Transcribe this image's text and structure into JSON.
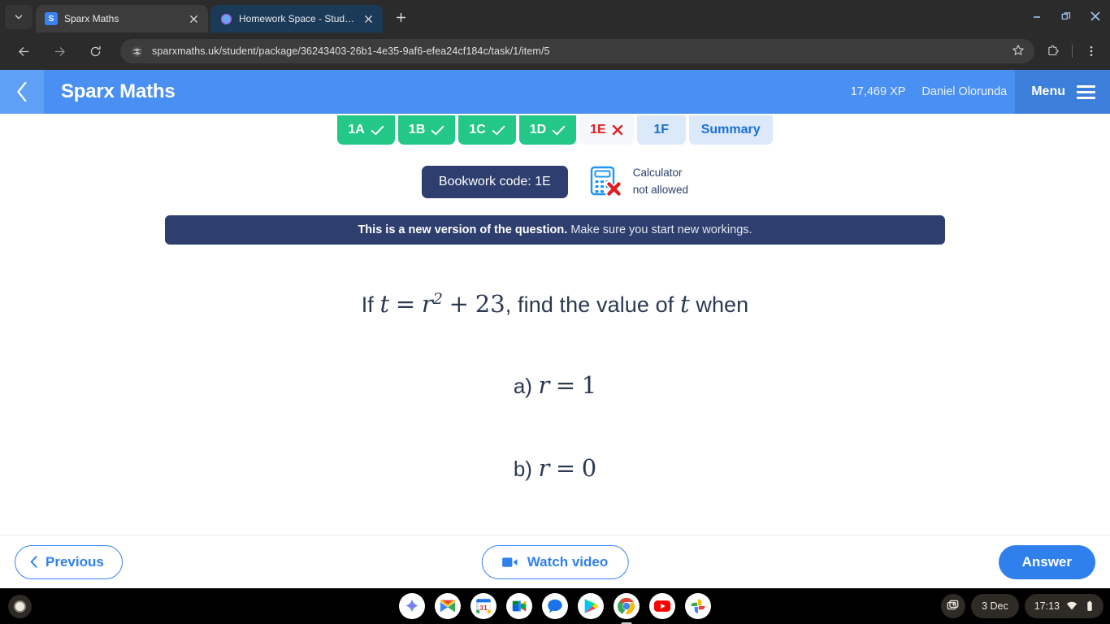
{
  "browser": {
    "tabs": [
      {
        "title": "Sparx Maths",
        "favicon": "sparx-icon",
        "active": true
      },
      {
        "title": "Homework Space - StudyX",
        "favicon": "studyx-icon",
        "active": false
      }
    ],
    "new_tab_label": "+",
    "url": "sparxmaths.uk/student/package/36243403-26b1-4e35-9af6-efea24cf184c/task/1/item/5",
    "window_controls": [
      "minimize",
      "restore",
      "close"
    ],
    "toolbar_icons": [
      "back-icon",
      "forward-icon",
      "reload-icon",
      "site-settings-icon",
      "bookmark-star-icon",
      "extensions-icon",
      "chrome-menu-icon"
    ]
  },
  "app_header": {
    "title": "Sparx Maths",
    "xp": "17,469 XP",
    "user": "Daniel Olorunda",
    "menu_label": "Menu",
    "accent": "#4a90f2",
    "menu_bg": "#3b7fdb"
  },
  "task_tabs": [
    {
      "label": "1A",
      "state": "done",
      "mark": "check"
    },
    {
      "label": "1B",
      "state": "done",
      "mark": "check"
    },
    {
      "label": "1C",
      "state": "done",
      "mark": "check"
    },
    {
      "label": "1D",
      "state": "done",
      "mark": "check"
    },
    {
      "label": "1E",
      "state": "current",
      "mark": "cross"
    },
    {
      "label": "1F",
      "state": "todo",
      "mark": "none"
    },
    {
      "label": "Summary",
      "state": "summary",
      "mark": "none"
    }
  ],
  "bookwork": {
    "code_label": "Bookwork code: 1E",
    "calculator_line1": "Calculator",
    "calculator_line2": "not allowed"
  },
  "banner": {
    "bold": "This is a new version of the question.",
    "rest": "Make sure you start new workings."
  },
  "question": {
    "prefix": "If",
    "var_t": "t",
    "equals": "=",
    "var_r": "r",
    "exponent": "2",
    "plus": "+",
    "constant": "23",
    "comma": ",",
    "middle": "find the value of",
    "var_t2": "t",
    "suffix": "when",
    "parts": [
      {
        "label": "a)",
        "variable": "r",
        "equals": "=",
        "value": "1"
      },
      {
        "label": "b)",
        "variable": "r",
        "equals": "=",
        "value": "0"
      }
    ]
  },
  "footer": {
    "previous": "Previous",
    "watch_video": "Watch video",
    "answer": "Answer"
  },
  "shelf": {
    "apps": [
      "gemini-icon",
      "gmail-icon",
      "calendar-icon",
      "meet-icon",
      "messages-icon",
      "play-store-icon",
      "chrome-icon",
      "youtube-icon",
      "photos-icon"
    ],
    "date": "3 Dec",
    "time": "17:13",
    "status_icons": [
      "wifi-icon",
      "battery-icon"
    ],
    "tray_icon": "screen-capture-icon"
  }
}
